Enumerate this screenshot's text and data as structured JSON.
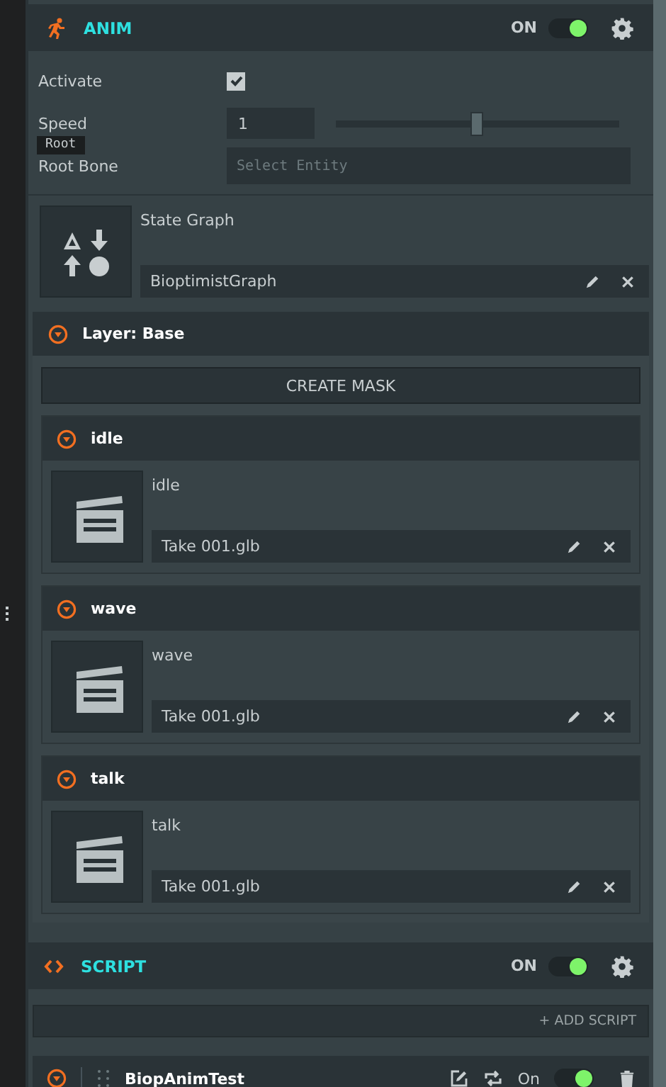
{
  "anim": {
    "title": "ANIM",
    "toggle_label": "ON",
    "on": true,
    "fields": [
      {
        "kind": "checkbox",
        "label": "Activate",
        "checked": true
      },
      {
        "kind": "slider",
        "label": "Speed",
        "value": "1",
        "level": 0.5
      },
      {
        "kind": "entity",
        "label": "Root Bone",
        "placeholder": "Select Entity"
      }
    ],
    "tooltip": "Root",
    "state_graph": {
      "label": "State Graph",
      "value": "BioptimistGraph"
    },
    "layer": {
      "title": "Layer: Base",
      "expanded": true,
      "mask_button": "CREATE MASK",
      "states": [
        {
          "title": "idle",
          "expanded": true,
          "label": "idle",
          "value": "Take 001.glb"
        },
        {
          "title": "wave",
          "expanded": true,
          "label": "wave",
          "value": "Take 001.glb"
        },
        {
          "title": "talk",
          "expanded": true,
          "label": "talk",
          "value": "Take 001.glb"
        }
      ]
    }
  },
  "script": {
    "title": "SCRIPT",
    "toggle_label": "ON",
    "on": true,
    "add_button": "+ ADD SCRIPT",
    "scripts": [
      {
        "name": "BiopAnimTest",
        "expanded": true,
        "toggle_label": "On",
        "on": true
      }
    ]
  }
}
